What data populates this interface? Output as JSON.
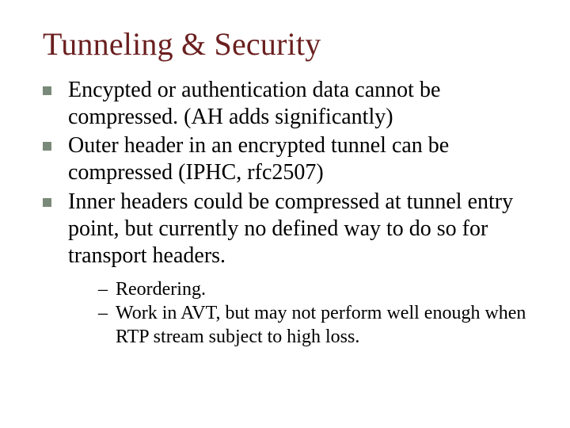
{
  "title": "Tunneling & Security",
  "bullets": [
    "Encypted or authentication data cannot be compressed. (AH adds significantly)",
    "Outer header in an encrypted tunnel can be compressed (IPHC, rfc2507)",
    "Inner headers could be compressed at tunnel entry point, but currently no defined way to do so for transport headers."
  ],
  "subbullets": [
    "Reordering.",
    "Work in AVT, but may not perform well enough when RTP stream subject to high loss."
  ],
  "dash": "–"
}
